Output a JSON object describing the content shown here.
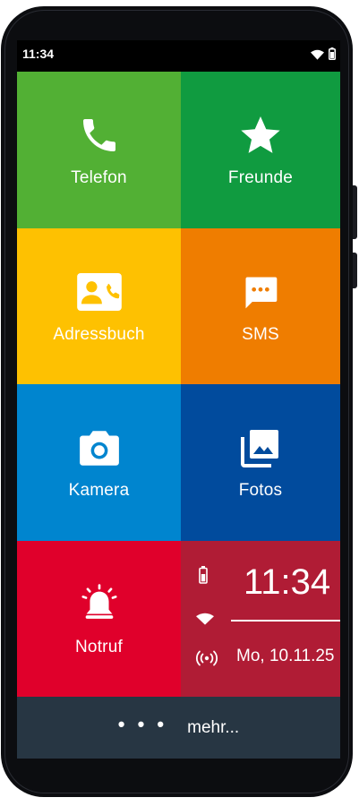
{
  "status_bar": {
    "time": "11:34",
    "icons": [
      "wifi-icon",
      "battery-icon"
    ]
  },
  "tiles": [
    {
      "label": "Telefon",
      "icon": "phone-icon",
      "color": "#52b034"
    },
    {
      "label": "Freunde",
      "icon": "star-icon",
      "color": "#109b40"
    },
    {
      "label": "Adressbuch",
      "icon": "contact-card-icon",
      "color": "#fec101"
    },
    {
      "label": "SMS",
      "icon": "message-icon",
      "color": "#ef7d00"
    },
    {
      "label": "Kamera",
      "icon": "camera-icon",
      "color": "#0085cf"
    },
    {
      "label": "Fotos",
      "icon": "photo-library-icon",
      "color": "#014b9d"
    },
    {
      "label": "Notruf",
      "icon": "alarm-bell-icon",
      "color": "#e0002b"
    }
  ],
  "clock_widget": {
    "time": "11:34",
    "date": "Mo, 10.11.25",
    "icons": [
      "battery-icon",
      "wifi-icon",
      "signal-broadcast-icon"
    ],
    "color": "#b01c35"
  },
  "bottom_bar": {
    "dots": "• • •",
    "label": "mehr...",
    "color": "#273643"
  }
}
